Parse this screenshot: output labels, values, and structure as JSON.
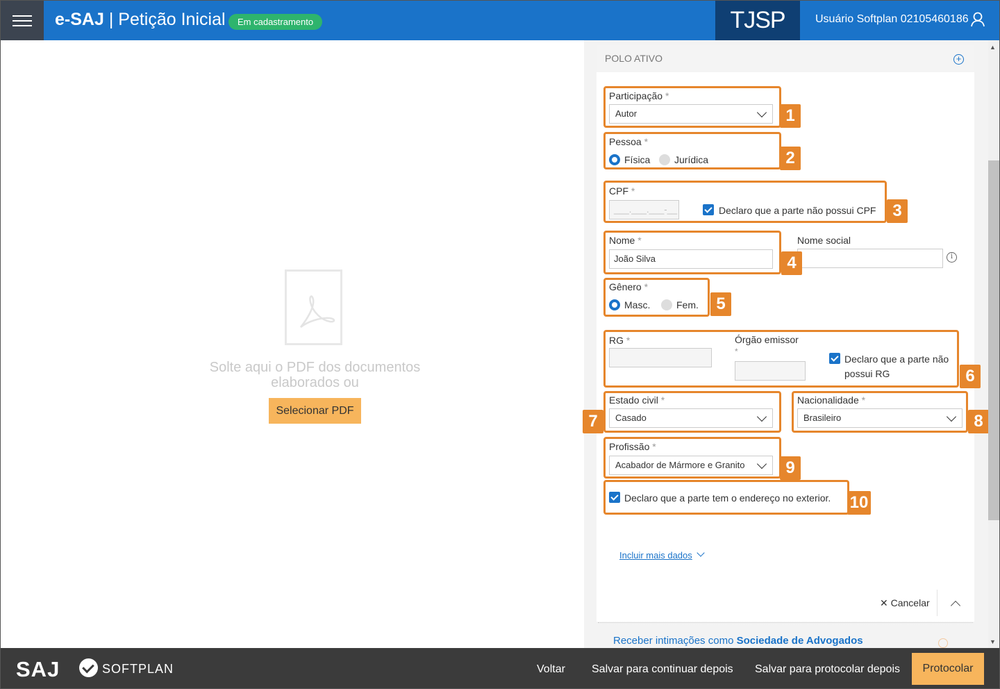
{
  "header": {
    "app_name": "e-SAJ",
    "page_title": "Petição Inicial",
    "status_badge": "Em cadastramento",
    "court": "TJSP",
    "user": "Usuário Softplan 02105460186"
  },
  "upload": {
    "drop_text": "Solte aqui o PDF dos documentos elaborados ou",
    "select_button": "Selecionar PDF"
  },
  "section": {
    "title": "POLO ATIVO"
  },
  "form": {
    "participacao": {
      "label": "Participação",
      "required": "*",
      "value": "Autor"
    },
    "pessoa": {
      "label": "Pessoa",
      "required": "*",
      "options": [
        "Física",
        "Jurídica"
      ],
      "selected": "Física"
    },
    "cpf": {
      "label": "CPF",
      "required": "*",
      "placeholder": "___.___.___-__",
      "no_cpf_label": "Declaro que a parte não possui CPF",
      "no_cpf_checked": true
    },
    "nome": {
      "label": "Nome",
      "required": "*",
      "value": "João Silva"
    },
    "nome_social": {
      "label": "Nome social",
      "value": ""
    },
    "genero": {
      "label": "Gênero",
      "required": "*",
      "options": [
        "Masc.",
        "Fem."
      ],
      "selected": "Masc."
    },
    "rg": {
      "label": "RG",
      "required": "*"
    },
    "orgao_emissor": {
      "label": "Órgão emissor",
      "required": "*"
    },
    "no_rg": {
      "label_line1": "Declaro que a parte não",
      "label_line2": "possui RG",
      "checked": true
    },
    "estado_civil": {
      "label": "Estado civil",
      "required": "*",
      "value": "Casado"
    },
    "nacionalidade": {
      "label": "Nacionalidade",
      "required": "*",
      "value": "Brasileiro"
    },
    "profissao": {
      "label": "Profissão",
      "required": "*",
      "value": "Acabador de Mármore e Granito"
    },
    "exterior": {
      "label": "Declaro que a parte tem o endereço no exterior.",
      "checked": true
    },
    "include_more": "Incluir mais dados",
    "cancel": "Cancelar"
  },
  "callouts": [
    "1",
    "2",
    "3",
    "4",
    "5",
    "6",
    "7",
    "8",
    "9",
    "10"
  ],
  "receive_link": {
    "prefix": "Receber intimações como",
    "bold": "Sociedade de Advogados"
  },
  "footer": {
    "brand_saj": "SAJ",
    "brand_softplan": "SOFTPLAN",
    "back": "Voltar",
    "save_continue": "Salvar para continuar depois",
    "save_protocol": "Salvar para protocolar depois",
    "protocol": "Protocolar"
  },
  "colors": {
    "header_blue": "#1a73c9",
    "court_navy": "#0f3f73",
    "badge_green": "#2eb46d",
    "highlight_orange": "#e6862c",
    "button_orange": "#f7b55c",
    "footer_gray": "#3b3b3b"
  }
}
